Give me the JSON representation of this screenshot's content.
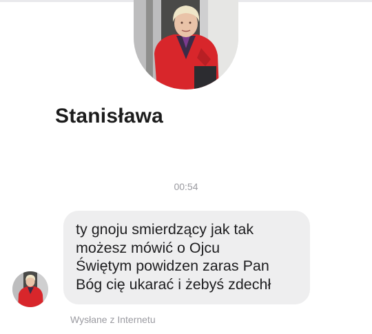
{
  "contact": {
    "name": "Stanisława",
    "avatar_icon": "profile-photo"
  },
  "conversation": {
    "timestamp": "00:54"
  },
  "message": {
    "text": "ty gnoju smierdzący jak tak\nmożesz mówić o Ojcu\nŚwiętym powidzen zaras Pan\nBóg cię ukarać i żebyś zdechł",
    "status": "Wysłane z Internetu",
    "sender_avatar_icon": "profile-photo"
  },
  "colors": {
    "bubble": "#eeeeef",
    "jacket": "#d8262b",
    "meta_text": "#9a9aa0"
  }
}
